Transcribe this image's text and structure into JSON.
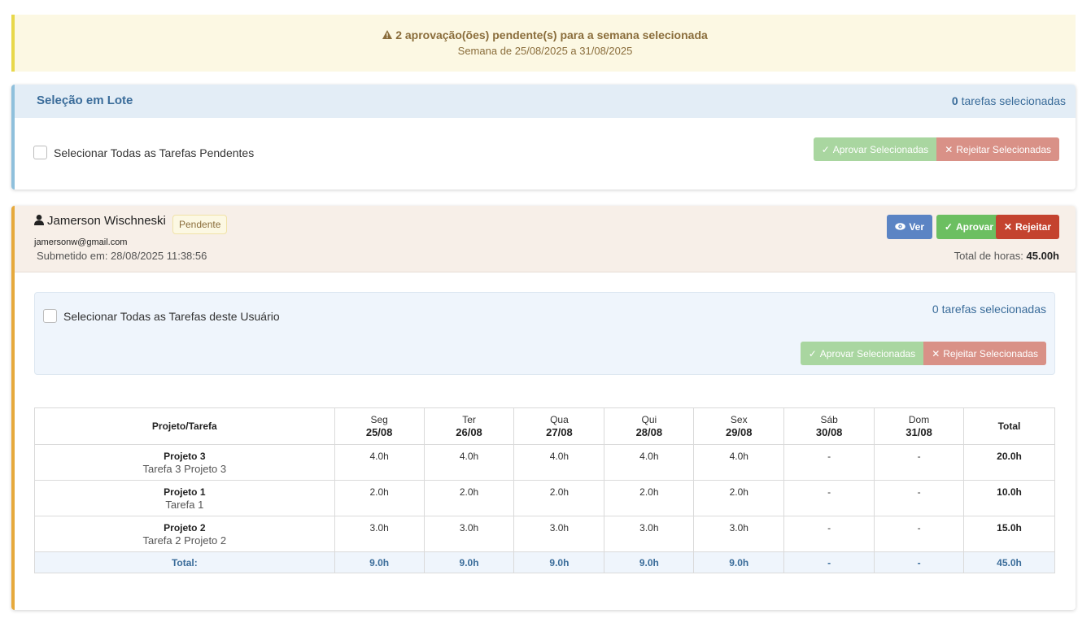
{
  "alert": {
    "icon": "warning-icon",
    "message": "2 aprovação(ões) pendente(s) para a semana selecionada",
    "week": "Semana de 25/08/2025 a 31/08/2025"
  },
  "batch": {
    "title": "Seleção em Lote",
    "count_number": "0",
    "count_label": " tarefas selecionadas",
    "select_all_label": "Selecionar Todas as Tarefas Pendentes",
    "approve_label": "Aprovar Selecionadas",
    "reject_label": "Rejeitar Selecionadas"
  },
  "user": {
    "name": "Jamerson Wischneski",
    "status": "Pendente",
    "email": "jamersonw@gmail.com",
    "submitted": "Submetido em: 28/08/2025 11:38:56",
    "total_label": "Total de horas: ",
    "total_value": "45.00h",
    "view_label": "Ver",
    "approve_label": "Aprovar",
    "reject_label": "Rejeitar",
    "select_all_label": "Selecionar Todas as Tarefas deste Usuário",
    "count_number": "0",
    "count_label": " tarefas selecionadas",
    "batch_approve_label": "Aprovar Selecionadas",
    "batch_reject_label": "Rejeitar Selecionadas"
  },
  "table": {
    "project_header": "Projeto/Tarefa",
    "days": [
      {
        "day": "Seg",
        "date": "25/08"
      },
      {
        "day": "Ter",
        "date": "26/08"
      },
      {
        "day": "Qua",
        "date": "27/08"
      },
      {
        "day": "Qui",
        "date": "28/08"
      },
      {
        "day": "Sex",
        "date": "29/08"
      },
      {
        "day": "Sáb",
        "date": "30/08"
      },
      {
        "day": "Dom",
        "date": "31/08"
      }
    ],
    "total_header": "Total",
    "rows": [
      {
        "project": "Projeto 3",
        "task": "Tarefa 3 Projeto 3",
        "hours": [
          "4.0h",
          "4.0h",
          "4.0h",
          "4.0h",
          "4.0h",
          "-",
          "-"
        ],
        "total": "20.0h"
      },
      {
        "project": "Projeto 1",
        "task": "Tarefa 1",
        "hours": [
          "2.0h",
          "2.0h",
          "2.0h",
          "2.0h",
          "2.0h",
          "-",
          "-"
        ],
        "total": "10.0h"
      },
      {
        "project": "Projeto 2",
        "task": "Tarefa 2 Projeto 2",
        "hours": [
          "3.0h",
          "3.0h",
          "3.0h",
          "3.0h",
          "3.0h",
          "-",
          "-"
        ],
        "total": "15.0h"
      }
    ],
    "footer_label": "Total:",
    "footer_hours": [
      "9.0h",
      "9.0h",
      "9.0h",
      "9.0h",
      "9.0h",
      "-",
      "-"
    ],
    "footer_total": "45.0h"
  }
}
